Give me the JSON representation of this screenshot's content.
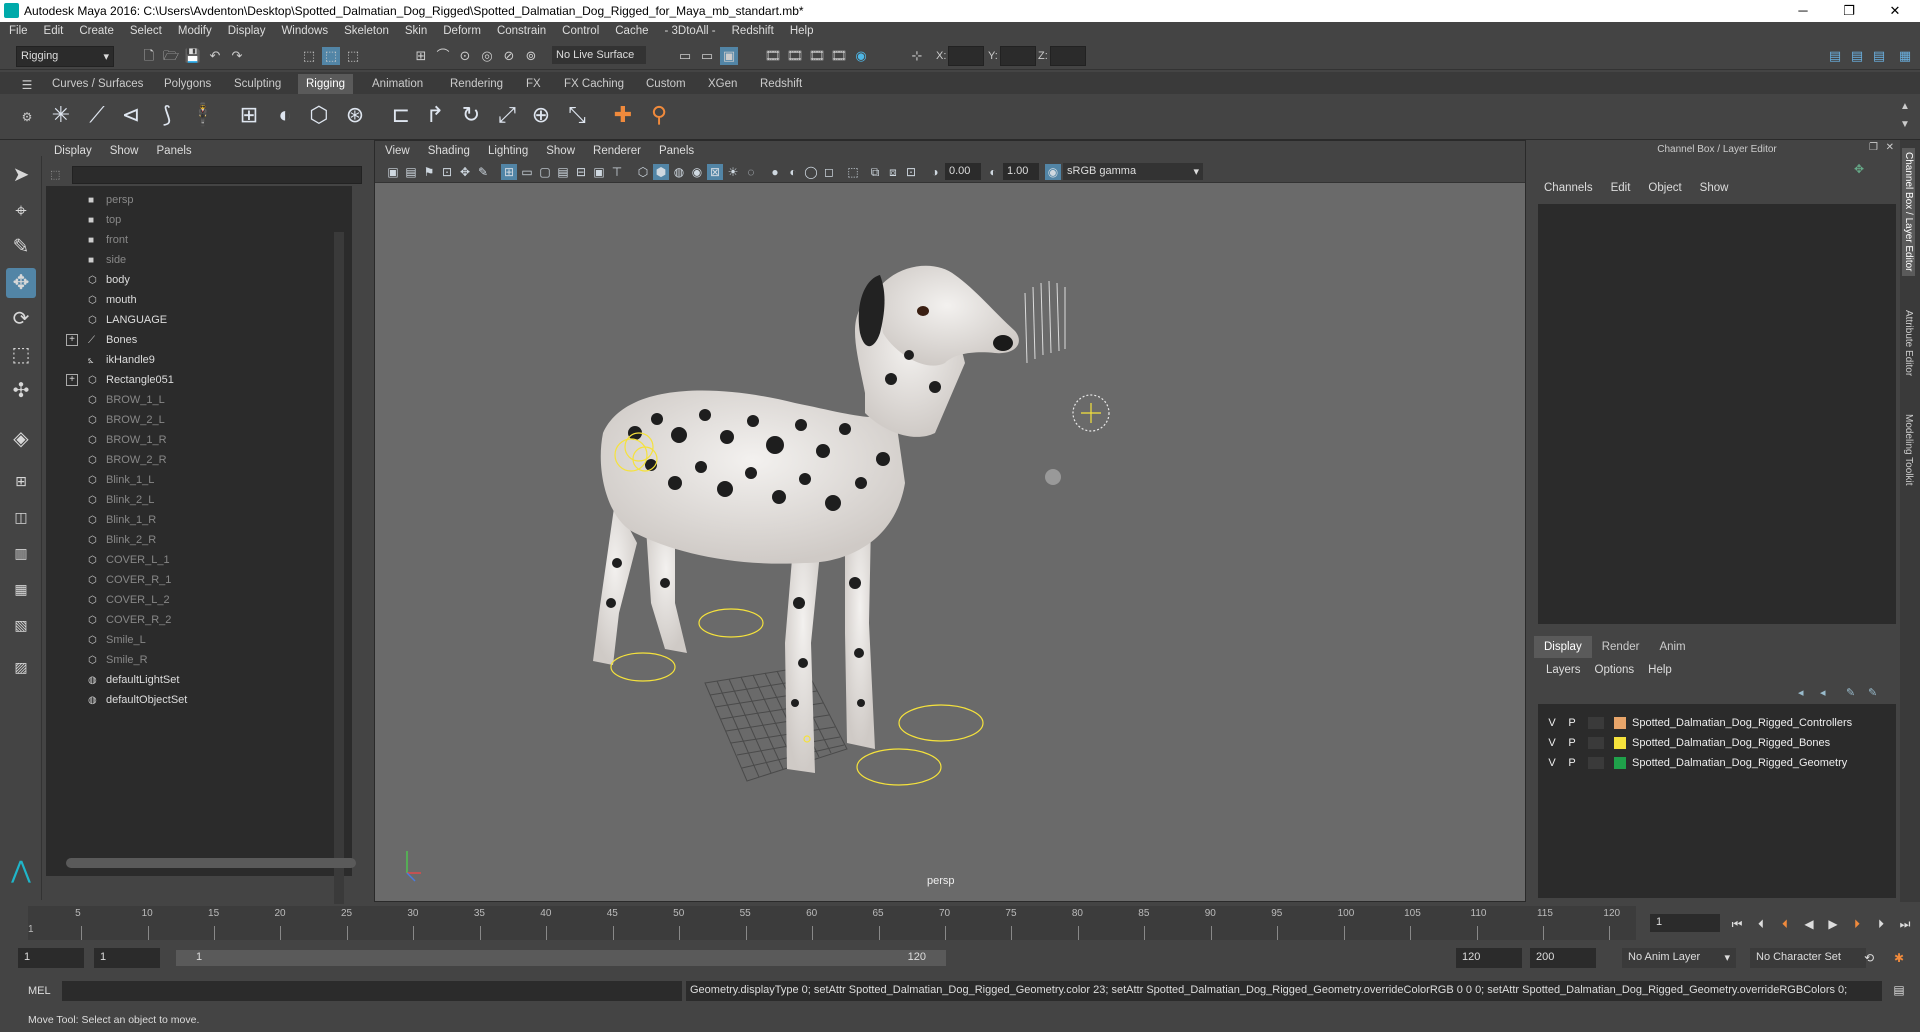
{
  "window": {
    "title": "Autodesk Maya 2016: C:\\Users\\Avdenton\\Desktop\\Spotted_Dalmatian_Dog_Rigged\\Spotted_Dalmatian_Dog_Rigged_for_Maya_mb_standart.mb*"
  },
  "menubar": [
    "File",
    "Edit",
    "Create",
    "Select",
    "Modify",
    "Display",
    "Windows",
    "Skeleton",
    "Skin",
    "Deform",
    "Constrain",
    "Control",
    "Cache",
    "- 3DtoAll -",
    "Redshift",
    "Help"
  ],
  "statusline": {
    "mode_select": "Rigging",
    "live_surface": "No Live Surface",
    "x_label": "X:",
    "y_label": "Y:",
    "z_label": "Z:"
  },
  "shelf_tabs": [
    {
      "label": "Curves / Surfaces",
      "active": false
    },
    {
      "label": "Polygons",
      "active": false
    },
    {
      "label": "Sculpting",
      "active": false
    },
    {
      "label": "Rigging",
      "active": true
    },
    {
      "label": "Animation",
      "active": false
    },
    {
      "label": "Rendering",
      "active": false
    },
    {
      "label": "FX",
      "active": false
    },
    {
      "label": "FX Caching",
      "active": false
    },
    {
      "label": "Custom",
      "active": false
    },
    {
      "label": "XGen",
      "active": false
    },
    {
      "label": "Redshift",
      "active": false
    }
  ],
  "outliner": {
    "menu": [
      "Display",
      "Show",
      "Panels"
    ],
    "items": [
      {
        "label": "persp",
        "icon": "camera-icon",
        "dim": true
      },
      {
        "label": "top",
        "icon": "camera-icon",
        "dim": true
      },
      {
        "label": "front",
        "icon": "camera-icon",
        "dim": true
      },
      {
        "label": "side",
        "icon": "camera-icon",
        "dim": true
      },
      {
        "label": "body",
        "icon": "mesh-icon",
        "dim": false
      },
      {
        "label": "mouth",
        "icon": "mesh-icon",
        "dim": false
      },
      {
        "label": "LANGUAGE",
        "icon": "mesh-icon",
        "dim": false
      },
      {
        "label": "Bones",
        "icon": "joint-icon",
        "dim": false,
        "expand": true
      },
      {
        "label": "ikHandle9",
        "icon": "ik-icon",
        "dim": false
      },
      {
        "label": "Rectangle051",
        "icon": "mesh-icon",
        "dim": false,
        "expand": true
      },
      {
        "label": "BROW_1_L",
        "icon": "mesh-icon",
        "dim": true
      },
      {
        "label": "BROW_2_L",
        "icon": "mesh-icon",
        "dim": true
      },
      {
        "label": "BROW_1_R",
        "icon": "mesh-icon",
        "dim": true
      },
      {
        "label": "BROW_2_R",
        "icon": "mesh-icon",
        "dim": true
      },
      {
        "label": "Blink_1_L",
        "icon": "mesh-icon",
        "dim": true
      },
      {
        "label": "Blink_2_L",
        "icon": "mesh-icon",
        "dim": true
      },
      {
        "label": "Blink_1_R",
        "icon": "mesh-icon",
        "dim": true
      },
      {
        "label": "Blink_2_R",
        "icon": "mesh-icon",
        "dim": true
      },
      {
        "label": "COVER_L_1",
        "icon": "mesh-icon",
        "dim": true
      },
      {
        "label": "COVER_R_1",
        "icon": "mesh-icon",
        "dim": true
      },
      {
        "label": "COVER_L_2",
        "icon": "mesh-icon",
        "dim": true
      },
      {
        "label": "COVER_R_2",
        "icon": "mesh-icon",
        "dim": true
      },
      {
        "label": "Smile_L",
        "icon": "mesh-icon",
        "dim": true
      },
      {
        "label": "Smile_R",
        "icon": "mesh-icon",
        "dim": true
      },
      {
        "label": "defaultLightSet",
        "icon": "set-icon",
        "dim": false
      },
      {
        "label": "defaultObjectSet",
        "icon": "set-icon",
        "dim": false
      }
    ]
  },
  "viewport": {
    "menu": [
      "View",
      "Shading",
      "Lighting",
      "Show",
      "Renderer",
      "Panels"
    ],
    "exposure": "0.00",
    "gamma": "1.00",
    "color_space": "sRGB gamma",
    "camera_label": "persp"
  },
  "channelbox": {
    "title": "Channel Box / Layer Editor",
    "menu": [
      "Channels",
      "Edit",
      "Object",
      "Show"
    ],
    "layer_tabs": [
      {
        "label": "Display",
        "active": true
      },
      {
        "label": "Render",
        "active": false
      },
      {
        "label": "Anim",
        "active": false
      }
    ],
    "layer_menu": [
      "Layers",
      "Options",
      "Help"
    ],
    "layers": [
      {
        "v": "V",
        "p": "P",
        "color": "#e8a56a",
        "name": "Spotted_Dalmatian_Dog_Rigged_Controllers"
      },
      {
        "v": "V",
        "p": "P",
        "color": "#f5e23c",
        "name": "Spotted_Dalmatian_Dog_Rigged_Bones"
      },
      {
        "v": "V",
        "p": "P",
        "color": "#1fa14a",
        "name": "Spotted_Dalmatian_Dog_Rigged_Geometry"
      }
    ]
  },
  "side_tabs": [
    "Channel Box / Layer Editor",
    "Attribute Editor",
    "Modeling Toolkit"
  ],
  "timeline": {
    "ticks": [
      "5",
      "10",
      "15",
      "20",
      "25",
      "30",
      "35",
      "40",
      "45",
      "50",
      "55",
      "60",
      "65",
      "70",
      "75",
      "80",
      "85",
      "90",
      "95",
      "100",
      "105",
      "110",
      "115",
      "120"
    ],
    "start_marker": "1",
    "current_frame": "1"
  },
  "range": {
    "start": "1",
    "playback_start": "1",
    "slider_start": "1",
    "slider_end": "120",
    "playback_end": "120",
    "end": "200",
    "anim_layer": "No Anim Layer",
    "character_set": "No Character Set"
  },
  "cmd": {
    "label": "MEL",
    "output": "Geometry.displayType 0; setAttr Spotted_Dalmatian_Dog_Rigged_Geometry.color 23; setAttr Spotted_Dalmatian_Dog_Rigged_Geometry.overrideColorRGB 0 0 0; setAttr Spotted_Dalmatian_Dog_Rigged_Geometry.overrideRGBColors 0;"
  },
  "help_line": "Move Tool: Select an object to move."
}
